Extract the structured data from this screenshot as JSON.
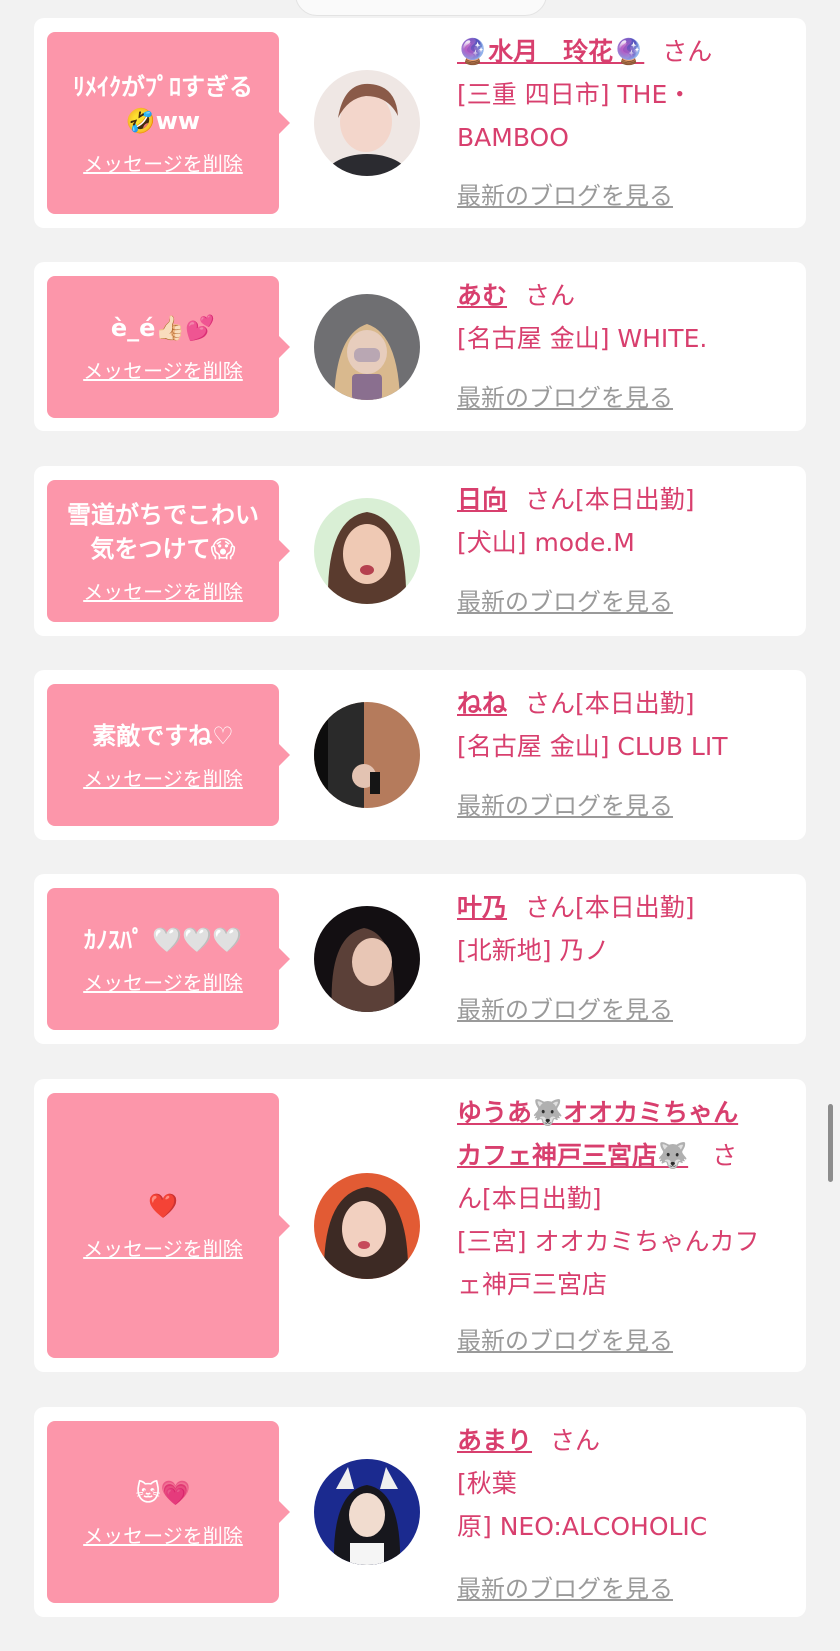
{
  "common": {
    "delete_label": "メッセージを削除",
    "blog_label": "最新のブログを見る",
    "san": "さん",
    "accent_color": "#fc96aa",
    "text_color": "#d83f6e"
  },
  "cards": [
    {
      "message": "ﾘﾒｲｸがﾌﾟﾛすぎる\n🤣ww",
      "name": "🔮水月　玲花🔮",
      "status": "",
      "store_lines": [
        "[三重 四日市] THE・",
        "BAMBOO"
      ]
    },
    {
      "message": "è_é👍🏻💕",
      "name": "あむ",
      "status": "",
      "store_lines": [
        "[名古屋 金山] WHITE."
      ]
    },
    {
      "message": "雪道がちでこわい\n気をつけて😱",
      "name": "日向",
      "status": "[本日出勤]",
      "store_lines": [
        "[犬山] mode.M"
      ]
    },
    {
      "message": "素敵ですね♡",
      "name": "ねね",
      "status": "[本日出勤]",
      "store_lines": [
        "[名古屋 金山] CLUB LIT"
      ]
    },
    {
      "message": "ｶﾉｽﾊﾟ 🤍🤍🤍",
      "name": "叶乃",
      "status": "[本日出勤]",
      "store_lines": [
        "[北新地] 乃ノ"
      ]
    },
    {
      "message": "❤️",
      "name_lines": [
        "ゆうあ🐺オオカミちゃん",
        "カフェ神戸三宮店🐺"
      ],
      "san_wrap": [
        "さ",
        "ん"
      ],
      "status": "[本日出勤]",
      "store_lines": [
        "[三宮] オオカミちゃんカフ",
        "ェ神戸三宮店"
      ]
    },
    {
      "message": "🐱💗",
      "name": "あまり",
      "status": "",
      "store_lines": [
        "[秋葉",
        "原] NEO:ALCOHOLIC"
      ]
    }
  ]
}
